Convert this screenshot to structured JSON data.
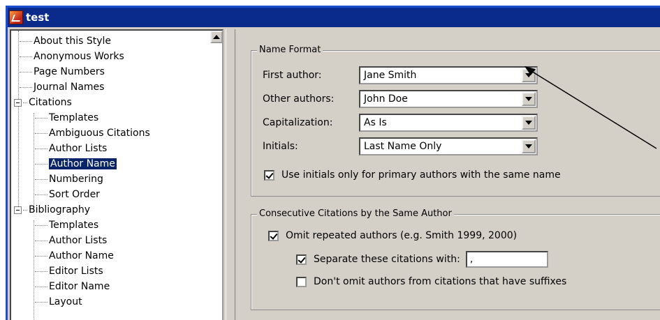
{
  "window": {
    "title": "test"
  },
  "tree": {
    "items": [
      {
        "label": "About this Style",
        "level": 1
      },
      {
        "label": "Anonymous Works",
        "level": 1
      },
      {
        "label": "Page Numbers",
        "level": 1
      },
      {
        "label": "Journal Names",
        "level": 1
      },
      {
        "label": "Citations",
        "level": 0,
        "expanded": true
      },
      {
        "label": "Templates",
        "level": 2
      },
      {
        "label": "Ambiguous Citations",
        "level": 2
      },
      {
        "label": "Author Lists",
        "level": 2
      },
      {
        "label": "Author Name",
        "level": 2,
        "selected": true
      },
      {
        "label": "Numbering",
        "level": 2
      },
      {
        "label": "Sort Order",
        "level": 2
      },
      {
        "label": "Bibliography",
        "level": 0,
        "expanded": true
      },
      {
        "label": "Templates",
        "level": 2
      },
      {
        "label": "Author Lists",
        "level": 2
      },
      {
        "label": "Author Name",
        "level": 2
      },
      {
        "label": "Editor Lists",
        "level": 2
      },
      {
        "label": "Editor Name",
        "level": 2
      },
      {
        "label": "Layout",
        "level": 2
      }
    ]
  },
  "name_format": {
    "legend": "Name Format",
    "first_author": {
      "label": "First author:",
      "value": "Jane Smith"
    },
    "other_authors": {
      "label": "Other authors:",
      "value": "John Doe"
    },
    "capitalization": {
      "label": "Capitalization:",
      "value": "As Is"
    },
    "initials": {
      "label": "Initials:",
      "value": "Last Name Only"
    },
    "use_initials": {
      "label": "Use initials only for primary authors with the same name",
      "checked": true
    }
  },
  "consecutive": {
    "legend": "Consecutive Citations by the Same Author",
    "omit_repeated": {
      "label": "Omit repeated authors (e.g. Smith 1999, 2000)",
      "checked": true
    },
    "separate": {
      "label": "Separate these citations with:",
      "checked": true,
      "value": ","
    },
    "dont_omit": {
      "label": "Don't omit authors from citations that have suffixes",
      "checked": false
    }
  },
  "icons": {
    "app": "app-icon",
    "dropdown": "chevron-down-icon",
    "scroll_up": "scroll-up-icon"
  },
  "colors": {
    "titlebar": "#0a2a8c",
    "selection": "#0a246a",
    "face": "#d4d0c8"
  }
}
